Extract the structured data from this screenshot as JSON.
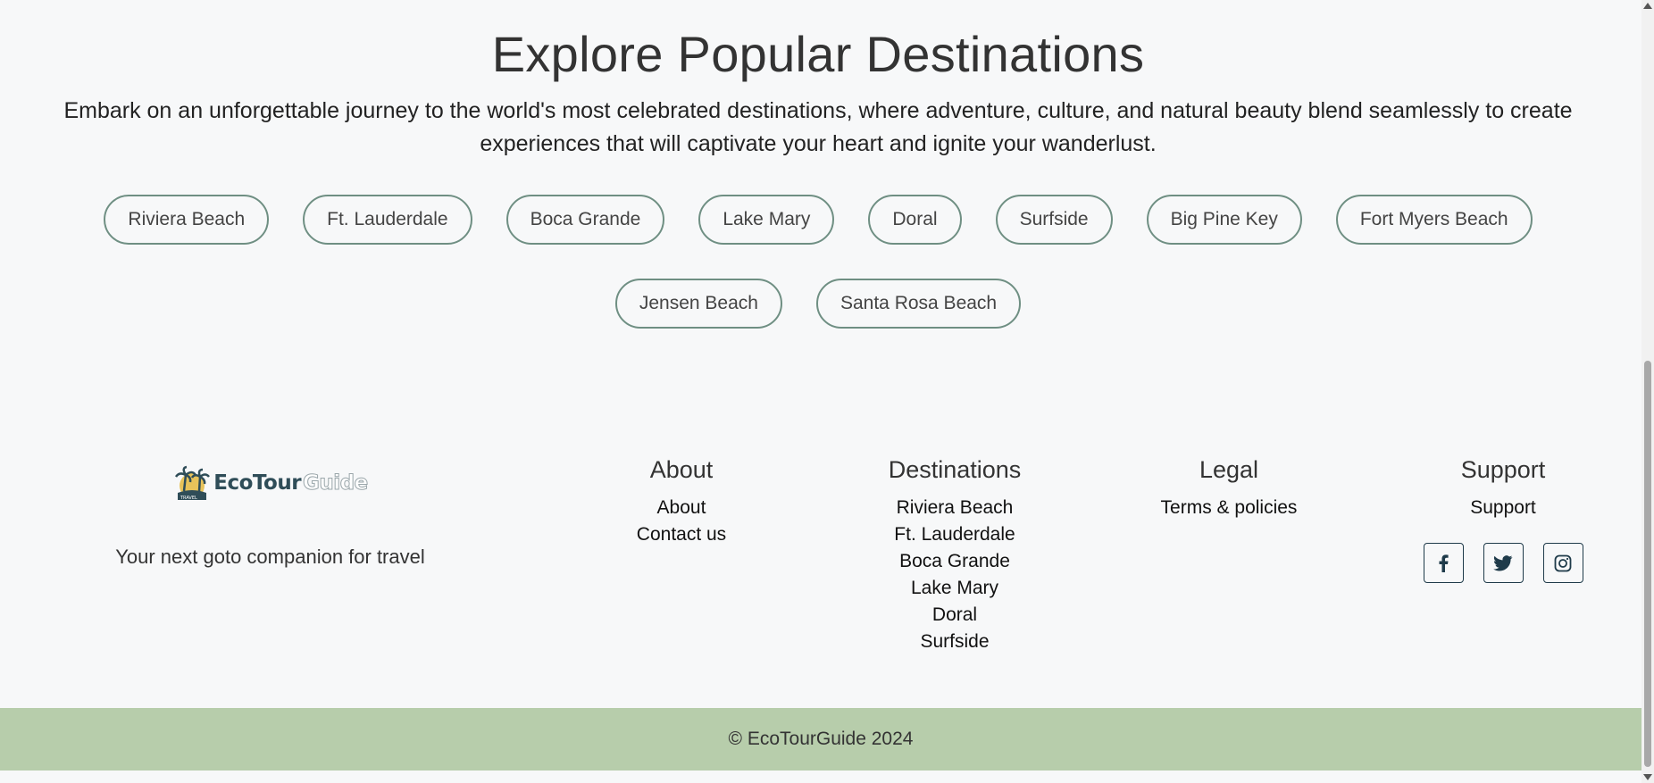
{
  "section": {
    "title": "Explore Popular Destinations",
    "description": "Embark on an unforgettable journey to the world's most celebrated destinations, where adventure, culture, and natural beauty blend seamlessly to create experiences that will captivate your heart and ignite your wanderlust."
  },
  "destinations": [
    "Riviera Beach",
    "Ft. Lauderdale",
    "Boca Grande",
    "Lake Mary",
    "Doral",
    "Surfside",
    "Big Pine Key",
    "Fort Myers Beach",
    "Jensen Beach",
    "Santa Rosa Beach"
  ],
  "footer": {
    "brand": {
      "logo_part1": "EcoTour",
      "logo_part2": "Guide",
      "logo_badge": "TRAVEL",
      "tagline": "Your next goto companion for travel"
    },
    "about": {
      "title": "About",
      "links": [
        "About",
        "Contact us"
      ]
    },
    "destinations": {
      "title": "Destinations",
      "links": [
        "Riviera Beach",
        "Ft. Lauderdale",
        "Boca Grande",
        "Lake Mary",
        "Doral",
        "Surfside"
      ]
    },
    "legal": {
      "title": "Legal",
      "links": [
        "Terms & policies"
      ]
    },
    "support": {
      "title": "Support",
      "links": [
        "Support"
      ],
      "socials": [
        "facebook-icon",
        "twitter-icon",
        "instagram-icon"
      ]
    },
    "copyright": "© EcoTourGuide 2024"
  },
  "colors": {
    "background": "#f7f8f9",
    "chip_border": "#6f8f83",
    "bottom_bar": "#b7cdab",
    "brand_dark": "#2f4d58"
  }
}
